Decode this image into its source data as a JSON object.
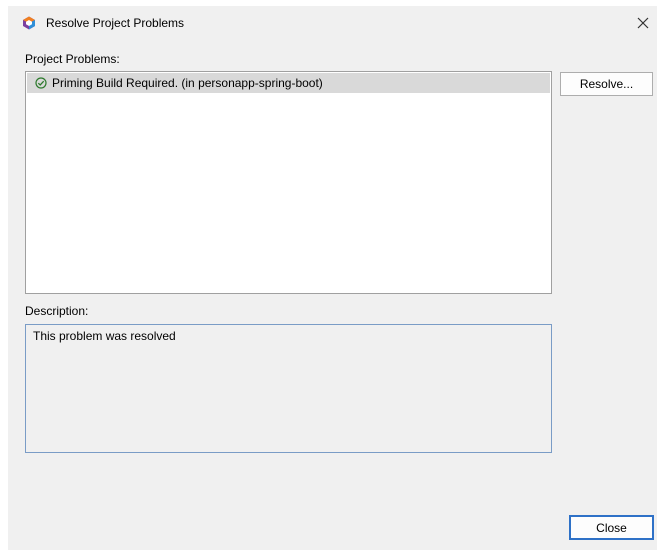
{
  "window": {
    "title": "Resolve Project Problems",
    "app_icon": "netbeans-hexagon-icon",
    "close_icon": "close-icon"
  },
  "problems": {
    "label": "Project Problems:",
    "items": [
      {
        "status_icon": "check-circle-icon",
        "text": "Priming Build Required. (in personapp-spring-boot)",
        "selected": true
      }
    ],
    "resolve_label": "Resolve..."
  },
  "description": {
    "label": "Description:",
    "text": "This problem was resolved"
  },
  "footer": {
    "close_label": "Close"
  },
  "colors": {
    "dialog_bg": "#f0f0f0",
    "selection_bg": "#d9d9d9",
    "focus_border": "#2e71c7",
    "description_border": "#7a9cc6",
    "icon_orange": "#f07f20",
    "icon_purple": "#7b3fa0",
    "icon_blue": "#2f8fd8",
    "check_green": "#2d7a2d"
  }
}
